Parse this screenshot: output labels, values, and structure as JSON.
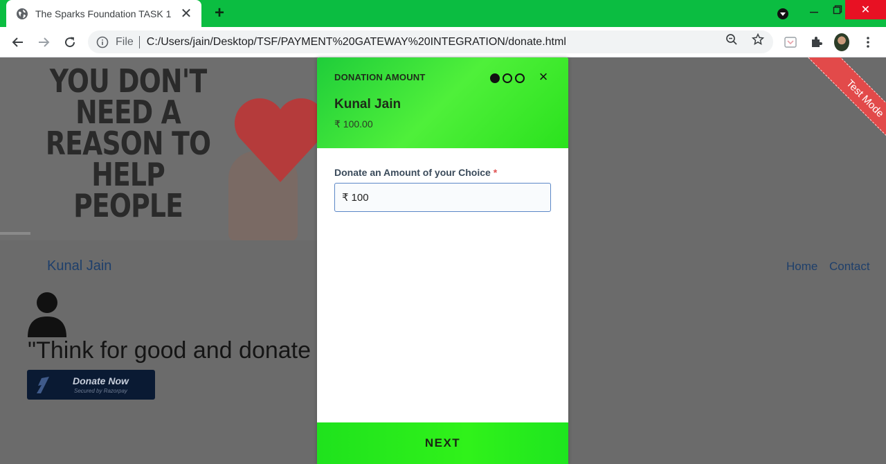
{
  "browser": {
    "tab_title": "The Sparks Foundation TASK 1",
    "address_scheme": "File",
    "address_url": "C:/Users/jain/Desktop/TSF/PAYMENT%20GATEWAY%20INTEGRATION/donate.html",
    "accent_color": "#0bbd41"
  },
  "page": {
    "hero_text": "YOU DON'T NEED A REASON TO HELP PEOPLE",
    "brand": "Kunal Jain",
    "nav": {
      "home": "Home",
      "contact": "Contact"
    },
    "quote": "\"Think for good and donate",
    "donate_button": {
      "label": "Donate Now",
      "subtext": "Secured by Razorpay"
    },
    "ribbon": "Test Mode"
  },
  "modal": {
    "header_title": "DONATION AMOUNT",
    "steps_total": 3,
    "steps_active": 1,
    "merchant_name": "Kunal Jain",
    "amount_display": "₹ 100.00",
    "field_label": "Donate an Amount of your Choice",
    "required_mark": "*",
    "currency_symbol": "₹",
    "field_value": "100",
    "next_label": "NEXT",
    "header_color": "#3ded35"
  }
}
